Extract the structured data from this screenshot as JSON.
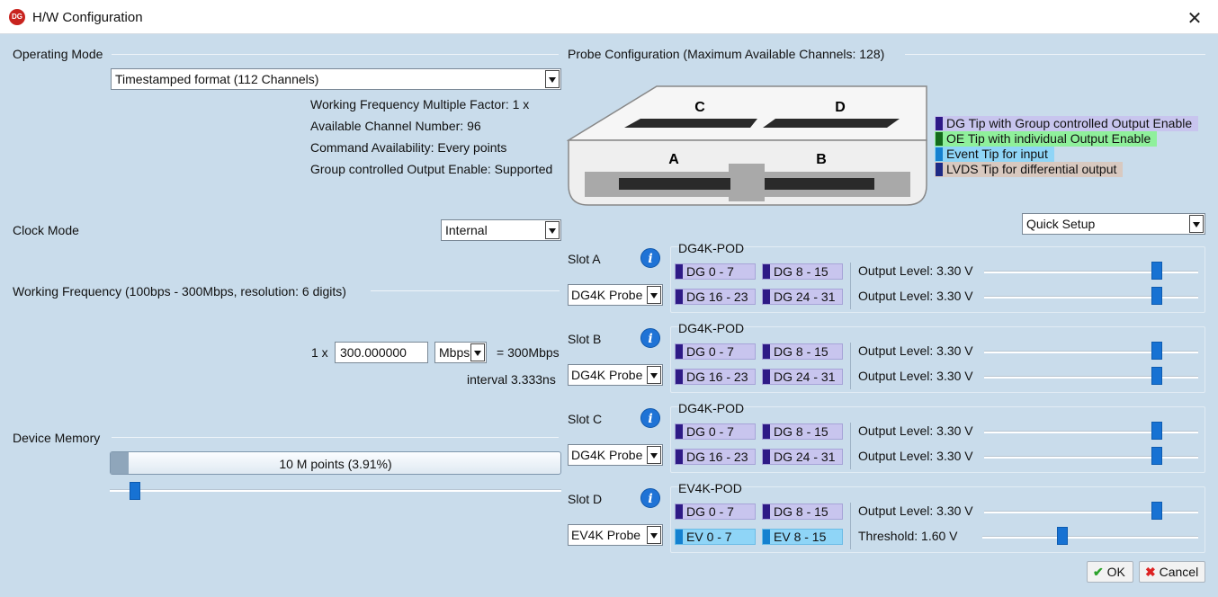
{
  "window": {
    "title": "H/W Configuration",
    "logo_text": "DG",
    "close_glyph": "✕"
  },
  "operating_mode": {
    "label": "Operating Mode",
    "selected": "Timestamped format (112 Channels)",
    "info": [
      "Working Frequency Multiple Factor: 1 x",
      "Available Channel Number: 96",
      "Command Availability: Every points",
      "Group controlled Output Enable: Supported"
    ]
  },
  "clock_mode": {
    "label": "Clock Mode",
    "selected": "Internal"
  },
  "working_frequency": {
    "label": "Working Frequency  (100bps - 300Mbps, resolution: 6 digits)",
    "multiplier": "1 x",
    "value": "300.000000",
    "unit": "Mbps",
    "result": "= 300Mbps",
    "interval": "interval  3.333ns"
  },
  "device_memory": {
    "label": "Device Memory",
    "value_text": "10 M points  (3.91%)",
    "percent": 3.91
  },
  "probe_config": {
    "label": "Probe Configuration  (Maximum Available Channels: 128)",
    "slots_diagram": [
      "C",
      "D",
      "A",
      "B"
    ],
    "legend": [
      {
        "text": "DG Tip with Group controlled Output Enable",
        "color": "#2e1a86",
        "bg": "#c8c5ee"
      },
      {
        "text": "OE Tip with individual Output Enable",
        "color": "#136a1c",
        "bg": "#8ff09b"
      },
      {
        "text": "Event Tip for input",
        "color": "#1581d0",
        "bg": "#8fd5f7"
      },
      {
        "text": "LVDS Tip for differential output",
        "color": "#1d2a86",
        "bg": "#d8c9c0"
      }
    ],
    "quick_setup": "Quick Setup"
  },
  "slots": [
    {
      "label": "Slot A",
      "probe": "DG4K Probe",
      "pod": "DG4K-POD",
      "rows": [
        {
          "chips": [
            {
              "text": "DG 0 - 7",
              "kind": "dg"
            },
            {
              "text": "DG 8 - 15",
              "kind": "dg"
            }
          ],
          "level_label": "Output Level: 3.30 V",
          "level": 3.3
        },
        {
          "chips": [
            {
              "text": "DG 16 - 23",
              "kind": "dg"
            },
            {
              "text": "DG 24 - 31",
              "kind": "dg"
            }
          ],
          "level_label": "Output Level: 3.30 V",
          "level": 3.3
        }
      ]
    },
    {
      "label": "Slot B",
      "probe": "DG4K Probe",
      "pod": "DG4K-POD",
      "rows": [
        {
          "chips": [
            {
              "text": "DG 0 - 7",
              "kind": "dg"
            },
            {
              "text": "DG 8 - 15",
              "kind": "dg"
            }
          ],
          "level_label": "Output Level: 3.30 V",
          "level": 3.3
        },
        {
          "chips": [
            {
              "text": "DG 16 - 23",
              "kind": "dg"
            },
            {
              "text": "DG 24 - 31",
              "kind": "dg"
            }
          ],
          "level_label": "Output Level: 3.30 V",
          "level": 3.3
        }
      ]
    },
    {
      "label": "Slot C",
      "probe": "DG4K Probe",
      "pod": "DG4K-POD",
      "rows": [
        {
          "chips": [
            {
              "text": "DG 0 - 7",
              "kind": "dg"
            },
            {
              "text": "DG 8 - 15",
              "kind": "dg"
            }
          ],
          "level_label": "Output Level: 3.30 V",
          "level": 3.3
        },
        {
          "chips": [
            {
              "text": "DG 16 - 23",
              "kind": "dg"
            },
            {
              "text": "DG 24 - 31",
              "kind": "dg"
            }
          ],
          "level_label": "Output Level: 3.30 V",
          "level": 3.3
        }
      ]
    },
    {
      "label": "Slot D",
      "probe": "EV4K Probe",
      "pod": "EV4K-POD",
      "rows": [
        {
          "chips": [
            {
              "text": "DG 0 - 7",
              "kind": "dg"
            },
            {
              "text": "DG 8 - 15",
              "kind": "dg"
            }
          ],
          "level_label": "Output Level: 3.30 V",
          "level": 3.3
        },
        {
          "chips": [
            {
              "text": "EV 0 - 7",
              "kind": "ev"
            },
            {
              "text": "EV 8 - 15",
              "kind": "ev"
            }
          ],
          "level_label": "Threshold: 1.60 V",
          "level": 1.6
        }
      ]
    }
  ],
  "buttons": {
    "ok": "OK",
    "cancel": "Cancel"
  },
  "icons": {
    "ok": "check-icon",
    "cancel": "x-icon",
    "info": "info-icon"
  }
}
